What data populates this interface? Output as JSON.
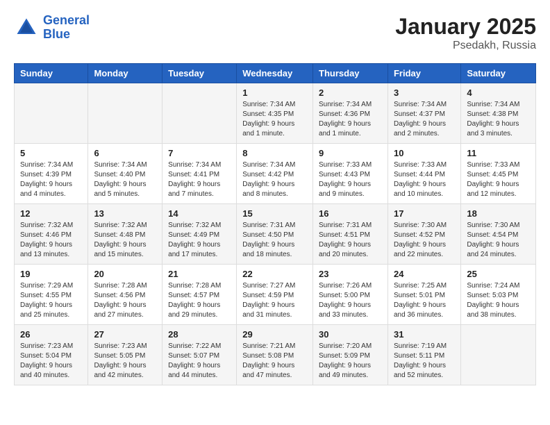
{
  "logo": {
    "line1": "General",
    "line2": "Blue"
  },
  "title": "January 2025",
  "subtitle": "Psedakh, Russia",
  "days_of_week": [
    "Sunday",
    "Monday",
    "Tuesday",
    "Wednesday",
    "Thursday",
    "Friday",
    "Saturday"
  ],
  "weeks": [
    [
      {
        "day": "",
        "content": ""
      },
      {
        "day": "",
        "content": ""
      },
      {
        "day": "",
        "content": ""
      },
      {
        "day": "1",
        "content": "Sunrise: 7:34 AM\nSunset: 4:35 PM\nDaylight: 9 hours\nand 1 minute."
      },
      {
        "day": "2",
        "content": "Sunrise: 7:34 AM\nSunset: 4:36 PM\nDaylight: 9 hours\nand 1 minute."
      },
      {
        "day": "3",
        "content": "Sunrise: 7:34 AM\nSunset: 4:37 PM\nDaylight: 9 hours\nand 2 minutes."
      },
      {
        "day": "4",
        "content": "Sunrise: 7:34 AM\nSunset: 4:38 PM\nDaylight: 9 hours\nand 3 minutes."
      }
    ],
    [
      {
        "day": "5",
        "content": "Sunrise: 7:34 AM\nSunset: 4:39 PM\nDaylight: 9 hours\nand 4 minutes."
      },
      {
        "day": "6",
        "content": "Sunrise: 7:34 AM\nSunset: 4:40 PM\nDaylight: 9 hours\nand 5 minutes."
      },
      {
        "day": "7",
        "content": "Sunrise: 7:34 AM\nSunset: 4:41 PM\nDaylight: 9 hours\nand 7 minutes."
      },
      {
        "day": "8",
        "content": "Sunrise: 7:34 AM\nSunset: 4:42 PM\nDaylight: 9 hours\nand 8 minutes."
      },
      {
        "day": "9",
        "content": "Sunrise: 7:33 AM\nSunset: 4:43 PM\nDaylight: 9 hours\nand 9 minutes."
      },
      {
        "day": "10",
        "content": "Sunrise: 7:33 AM\nSunset: 4:44 PM\nDaylight: 9 hours\nand 10 minutes."
      },
      {
        "day": "11",
        "content": "Sunrise: 7:33 AM\nSunset: 4:45 PM\nDaylight: 9 hours\nand 12 minutes."
      }
    ],
    [
      {
        "day": "12",
        "content": "Sunrise: 7:32 AM\nSunset: 4:46 PM\nDaylight: 9 hours\nand 13 minutes."
      },
      {
        "day": "13",
        "content": "Sunrise: 7:32 AM\nSunset: 4:48 PM\nDaylight: 9 hours\nand 15 minutes."
      },
      {
        "day": "14",
        "content": "Sunrise: 7:32 AM\nSunset: 4:49 PM\nDaylight: 9 hours\nand 17 minutes."
      },
      {
        "day": "15",
        "content": "Sunrise: 7:31 AM\nSunset: 4:50 PM\nDaylight: 9 hours\nand 18 minutes."
      },
      {
        "day": "16",
        "content": "Sunrise: 7:31 AM\nSunset: 4:51 PM\nDaylight: 9 hours\nand 20 minutes."
      },
      {
        "day": "17",
        "content": "Sunrise: 7:30 AM\nSunset: 4:52 PM\nDaylight: 9 hours\nand 22 minutes."
      },
      {
        "day": "18",
        "content": "Sunrise: 7:30 AM\nSunset: 4:54 PM\nDaylight: 9 hours\nand 24 minutes."
      }
    ],
    [
      {
        "day": "19",
        "content": "Sunrise: 7:29 AM\nSunset: 4:55 PM\nDaylight: 9 hours\nand 25 minutes."
      },
      {
        "day": "20",
        "content": "Sunrise: 7:28 AM\nSunset: 4:56 PM\nDaylight: 9 hours\nand 27 minutes."
      },
      {
        "day": "21",
        "content": "Sunrise: 7:28 AM\nSunset: 4:57 PM\nDaylight: 9 hours\nand 29 minutes."
      },
      {
        "day": "22",
        "content": "Sunrise: 7:27 AM\nSunset: 4:59 PM\nDaylight: 9 hours\nand 31 minutes."
      },
      {
        "day": "23",
        "content": "Sunrise: 7:26 AM\nSunset: 5:00 PM\nDaylight: 9 hours\nand 33 minutes."
      },
      {
        "day": "24",
        "content": "Sunrise: 7:25 AM\nSunset: 5:01 PM\nDaylight: 9 hours\nand 36 minutes."
      },
      {
        "day": "25",
        "content": "Sunrise: 7:24 AM\nSunset: 5:03 PM\nDaylight: 9 hours\nand 38 minutes."
      }
    ],
    [
      {
        "day": "26",
        "content": "Sunrise: 7:23 AM\nSunset: 5:04 PM\nDaylight: 9 hours\nand 40 minutes."
      },
      {
        "day": "27",
        "content": "Sunrise: 7:23 AM\nSunset: 5:05 PM\nDaylight: 9 hours\nand 42 minutes."
      },
      {
        "day": "28",
        "content": "Sunrise: 7:22 AM\nSunset: 5:07 PM\nDaylight: 9 hours\nand 44 minutes."
      },
      {
        "day": "29",
        "content": "Sunrise: 7:21 AM\nSunset: 5:08 PM\nDaylight: 9 hours\nand 47 minutes."
      },
      {
        "day": "30",
        "content": "Sunrise: 7:20 AM\nSunset: 5:09 PM\nDaylight: 9 hours\nand 49 minutes."
      },
      {
        "day": "31",
        "content": "Sunrise: 7:19 AM\nSunset: 5:11 PM\nDaylight: 9 hours\nand 52 minutes."
      },
      {
        "day": "",
        "content": ""
      }
    ]
  ]
}
